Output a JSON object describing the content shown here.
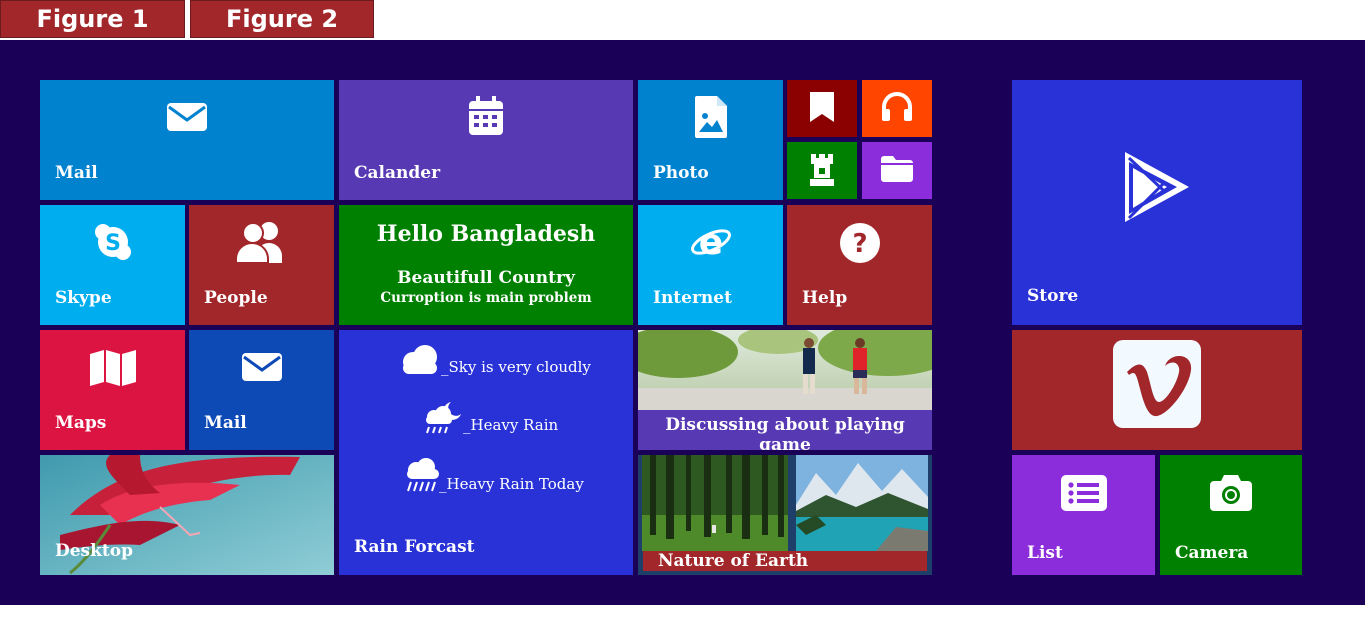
{
  "tabs": [
    "Figure 1",
    "Figure 2"
  ],
  "tiles": {
    "mail": "Mail",
    "calendar": "Calander",
    "photo": "Photo",
    "skype": "Skype",
    "people": "People",
    "hello_title": "Hello Bangladesh",
    "hello_line1": "Beautifull Country",
    "hello_line2": "Curroption is main problem",
    "internet": "Internet",
    "help": "Help",
    "store": "Store",
    "maps": "Maps",
    "mail2": "Mail",
    "rain_forecast": "Rain Forcast",
    "forecast_1": "Sky is very cloudly",
    "forecast_2": "Heavy Rain",
    "forecast_3": "Heavy Rain Today",
    "game": "Discussing about playing game",
    "desktop": "Desktop",
    "nature": "Nature of Earth",
    "list": "List",
    "camera": "Camera"
  },
  "colors": {
    "background": "#1a0157",
    "tab": "#a2272b",
    "blue": "#0082cf",
    "purple": "#5839b4",
    "green": "#008000",
    "red": "#a2272b",
    "cyan": "#00adee",
    "crimson": "#dc1442",
    "royal": "#2932d6",
    "violet": "#8c2ddb",
    "orange": "#ff4500",
    "maroon": "#8b0000"
  }
}
